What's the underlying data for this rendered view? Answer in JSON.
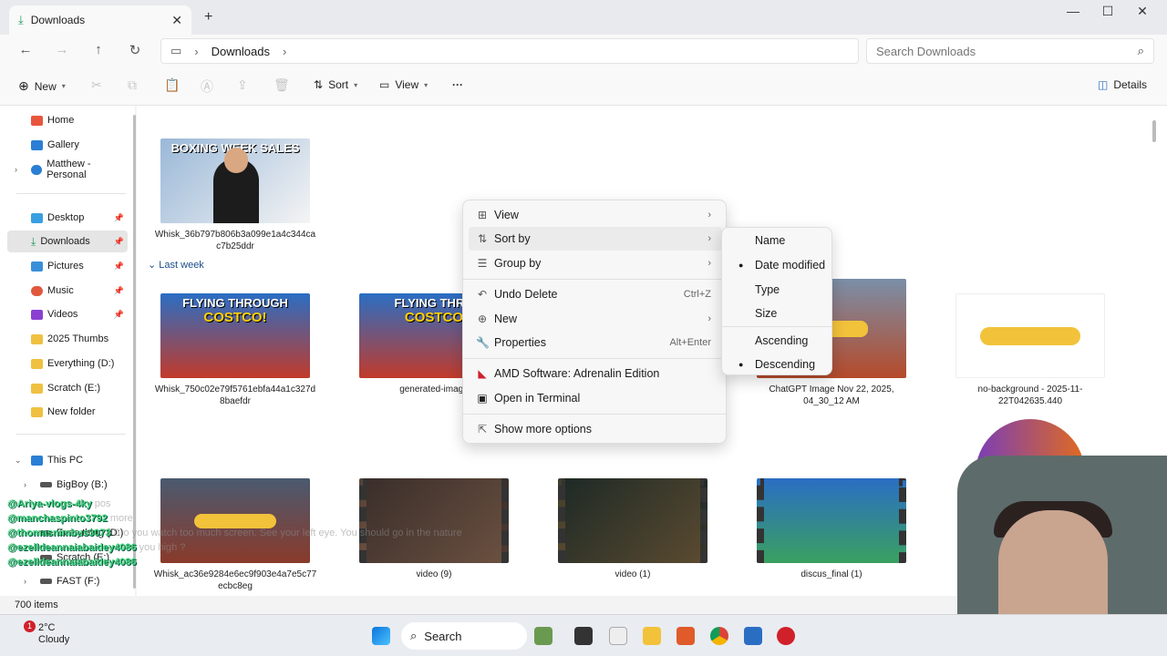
{
  "window": {
    "tab_title": "Downloads",
    "minimize": "—",
    "maximize": "☐",
    "close": "✕",
    "new_tab": "+"
  },
  "address": {
    "breadcrumb": [
      "Downloads"
    ],
    "search_placeholder": "Search Downloads"
  },
  "commandbar": {
    "new_label": "New",
    "sort_label": "Sort",
    "view_label": "View",
    "more_label": "···",
    "details_label": "Details"
  },
  "sidebar": {
    "items": [
      {
        "label": "Home",
        "color": "#e8553e"
      },
      {
        "label": "Gallery",
        "color": "#2a7fd4"
      },
      {
        "label": "Matthew - Personal",
        "color": "#2a7fd4"
      },
      {
        "label": "Desktop",
        "color": "#3a9fe0"
      },
      {
        "label": "Downloads",
        "color": "#1f9a5a"
      },
      {
        "label": "Pictures",
        "color": "#3a8fd8"
      },
      {
        "label": "Music",
        "color": "#e0583e"
      },
      {
        "label": "Videos",
        "color": "#8a3fd0"
      },
      {
        "label": "2025 Thumbs",
        "color": "#f0c040"
      },
      {
        "label": "Everything (D:)",
        "color": "#f0c040"
      },
      {
        "label": "Scratch (E:)",
        "color": "#f0c040"
      },
      {
        "label": "New folder",
        "color": "#f0c040"
      },
      {
        "label": "This PC",
        "color": "#2a7fd4"
      },
      {
        "label": "BigBoy (B:)",
        "color": "#555"
      },
      {
        "label": "Everything (D:)",
        "color": "#555"
      },
      {
        "label": "Scratch (E:)",
        "color": "#555"
      },
      {
        "label": "FAST (F:)",
        "color": "#555"
      }
    ]
  },
  "content": {
    "group_last_week": "Last week",
    "files": [
      {
        "name": "Whisk_36b797b806b3a099e1a4c344ca c7b25ddr",
        "caption": "BOXING WEEK SALES",
        "kind": "image"
      },
      {
        "name": "Whisk_750c02e79f5761ebfa44a1c327d 8baefdr",
        "caption": "FLYING THROUGH",
        "caption2": "COSTCO!",
        "kind": "image"
      },
      {
        "name": "generated-image",
        "caption": "FLYING THRO",
        "caption2": "COSTCO",
        "kind": "image"
      },
      {
        "name": "ChatGPT Image Nov 22, 2025, 04_30_12 AM",
        "kind": "image"
      },
      {
        "name": "no-background - 2025-11-22T042635.440",
        "kind": "image"
      },
      {
        "name": "Whisk_ac36e9284e6ec9f903e4a7e5c77 ecbc8eg",
        "kind": "image"
      },
      {
        "name": "video (9)",
        "kind": "video"
      },
      {
        "name": "video (1)",
        "kind": "video"
      },
      {
        "name": "discus_final (1)",
        "kind": "video"
      }
    ]
  },
  "context_menu": {
    "items": [
      {
        "label": "View",
        "icon": "grid-icon",
        "arrow": "›"
      },
      {
        "label": "Sort by",
        "icon": "sort-icon",
        "arrow": "›"
      },
      {
        "label": "Group by",
        "icon": "list-icon",
        "arrow": "›"
      },
      {
        "label": "Undo Delete",
        "icon": "undo-icon",
        "shortcut": "Ctrl+Z"
      },
      {
        "label": "New",
        "icon": "plus-icon",
        "arrow": "›"
      },
      {
        "label": "Properties",
        "icon": "wrench-icon",
        "shortcut": "Alt+Enter"
      },
      {
        "label": "AMD Software: Adrenalin Edition",
        "icon": "amd-icon"
      },
      {
        "label": "Open in Terminal",
        "icon": "terminal-icon"
      },
      {
        "label": "Show more options",
        "icon": "share-icon"
      }
    ]
  },
  "sort_submenu": {
    "items": [
      {
        "label": "Name",
        "selected": false
      },
      {
        "label": "Date modified",
        "selected": true
      },
      {
        "label": "Type",
        "selected": false
      },
      {
        "label": "Size",
        "selected": false
      },
      {
        "label": "Ascending",
        "selected": false
      },
      {
        "label": "Descending",
        "selected": true
      }
    ]
  },
  "status": {
    "item_count": "700 items"
  },
  "taskbar": {
    "temperature": "2°C",
    "condition": "Cloudy",
    "badge": "1",
    "search_label": "Search"
  },
  "chat_overlay": [
    {
      "user": "@Ariya-vlogs-4ky",
      "msg": "pos"
    },
    {
      "user": "@manchaspinto3792",
      "msg": "more"
    },
    {
      "user": "@thomasnimbus3073",
      "msg": "Bro you watch too much screen. See your left eye. You should go in the nature"
    },
    {
      "user": "@ezelldeannaiabaidey4086",
      "msg": "you high ?"
    },
    {
      "user": "@ezelldeannaiabaidey4086",
      "msg": ""
    }
  ]
}
